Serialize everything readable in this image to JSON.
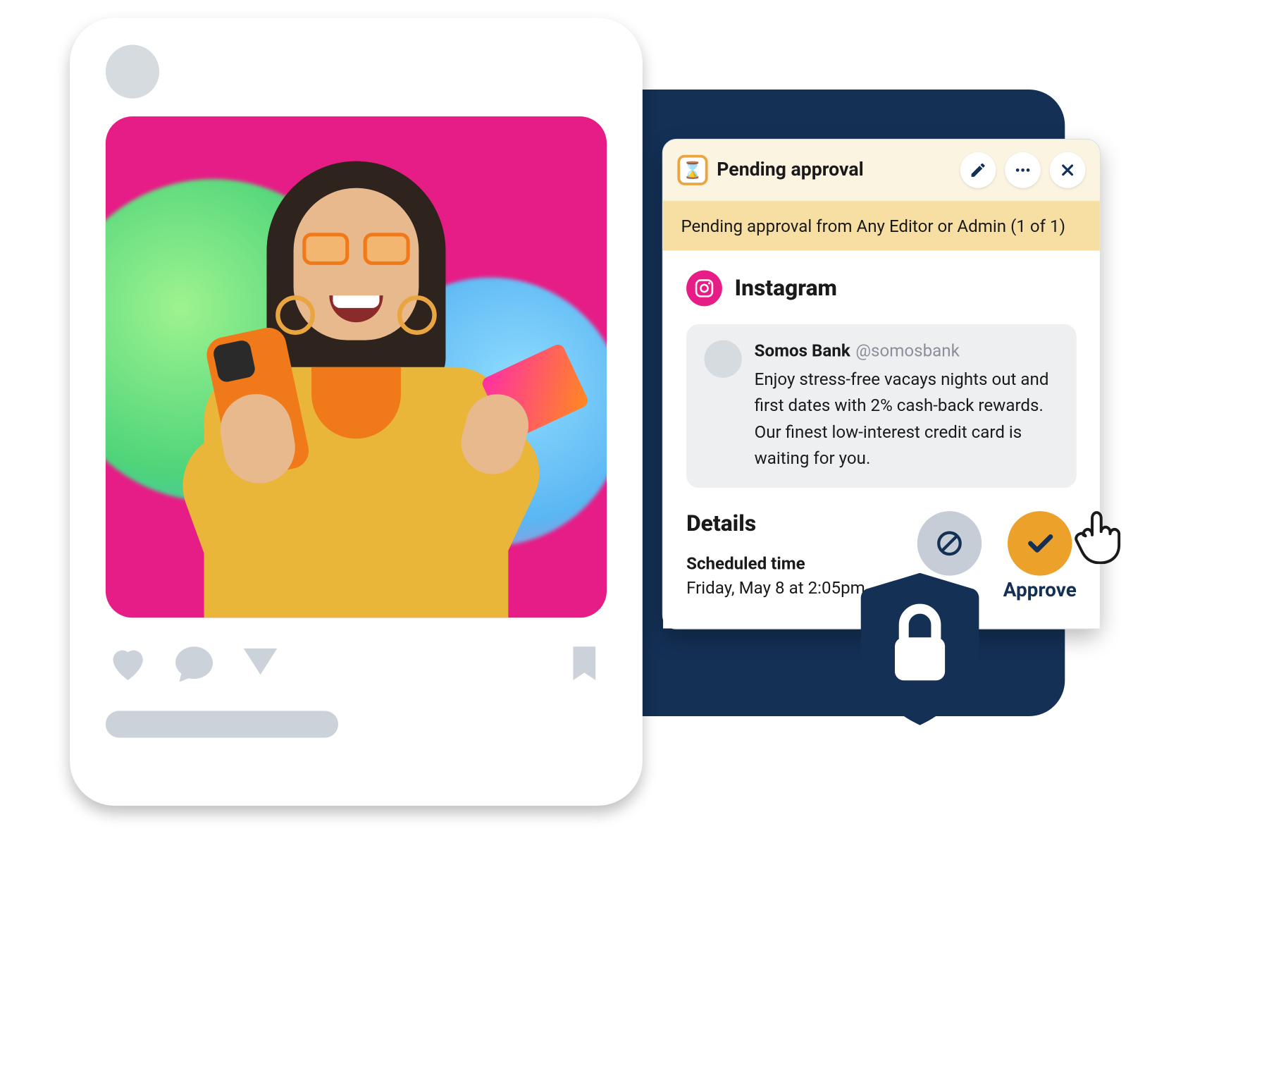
{
  "colors": {
    "navy": "#143055",
    "amber": "#eca12b",
    "pink": "#e61d87",
    "gray": "#cbd2d9"
  },
  "panel": {
    "title": "Pending approval",
    "sub": "Pending approval from Any Editor or Admin (1 of 1)",
    "platform": "Instagram",
    "account": {
      "name": "Somos Bank",
      "handle": "@somosbank"
    },
    "copy": "Enjoy stress-free vacays nights out and first dates with 2% cash-back rewards. Our finest low-interest credit card is waiting for you.",
    "details_heading": "Details",
    "scheduled_label": "Scheduled time",
    "scheduled_value": "Friday, May 8 at 2:05pm",
    "approve_label": "Approve"
  }
}
